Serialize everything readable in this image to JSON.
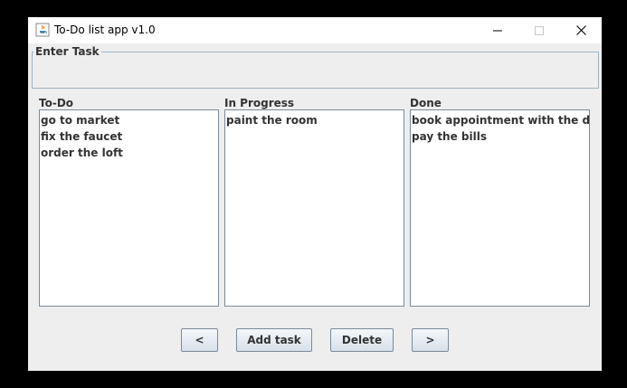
{
  "window": {
    "title": "To-Do list app v1.0",
    "icons": {
      "app": "java-coffee-icon",
      "minimize": "minimize-icon",
      "maximize": "maximize-icon",
      "close": "close-icon"
    }
  },
  "enter_task": {
    "legend": "Enter Task",
    "value": ""
  },
  "columns": {
    "todo": {
      "label": "To-Do",
      "items": [
        "go to market",
        "fix the faucet",
        "order the loft"
      ]
    },
    "in_progress": {
      "label": "In Progress",
      "items": [
        "paint the room"
      ]
    },
    "done": {
      "label": "Done",
      "items": [
        "book appointment with the dentist",
        "pay the bills"
      ]
    }
  },
  "buttons": {
    "move_left": "<",
    "add_task": "Add task",
    "delete": "Delete",
    "move_right": ">"
  },
  "colors": {
    "background": "#eeeeee",
    "titlebar": "#ffffff",
    "border": "#7a8a99",
    "text": "#333333"
  }
}
